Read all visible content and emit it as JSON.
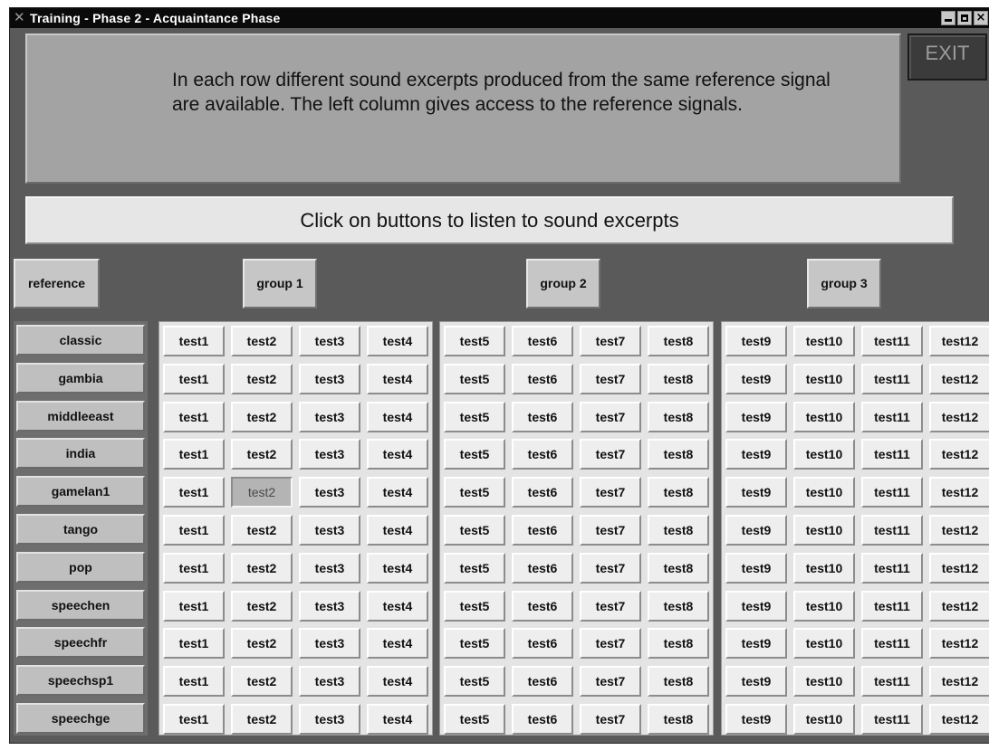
{
  "window": {
    "title": "Training - Phase 2 - Acquaintance Phase",
    "controls": [
      "minimize-icon",
      "maximize-icon",
      "close-icon"
    ],
    "close_glyph": "×"
  },
  "exit_label": "EXIT",
  "instructions": "In each row different sound excerpts produced from the same reference signal are available. The left column gives access to the reference signals.",
  "hint": "Click on buttons to  listen to sound excerpts",
  "headers": {
    "reference": "reference",
    "groups": [
      "group 1",
      "group 2",
      "group 3"
    ]
  },
  "rows": [
    "classic",
    "gambia",
    "middleeast",
    "india",
    "gamelan1",
    "tango",
    "pop",
    "speechen",
    "speechfr",
    "speechsp1",
    "speechge"
  ],
  "groups": [
    {
      "tests": [
        "test1",
        "test2",
        "test3",
        "test4"
      ]
    },
    {
      "tests": [
        "test5",
        "test6",
        "test7",
        "test8"
      ]
    },
    {
      "tests": [
        "test9",
        "test10",
        "test11",
        "test12"
      ]
    }
  ],
  "pressed": {
    "row": "gamelan1",
    "test": "test2"
  },
  "colors": {
    "window_bg": "#5a5a5a",
    "titlebar_bg": "#0a0a0a",
    "instructions_bg": "#a3a3a3",
    "hint_bg": "#e6e6e6",
    "panel_bg": "#e4e4e4",
    "button_bg": "#eeeeee",
    "pressed_bg": "#b4b4b4"
  }
}
